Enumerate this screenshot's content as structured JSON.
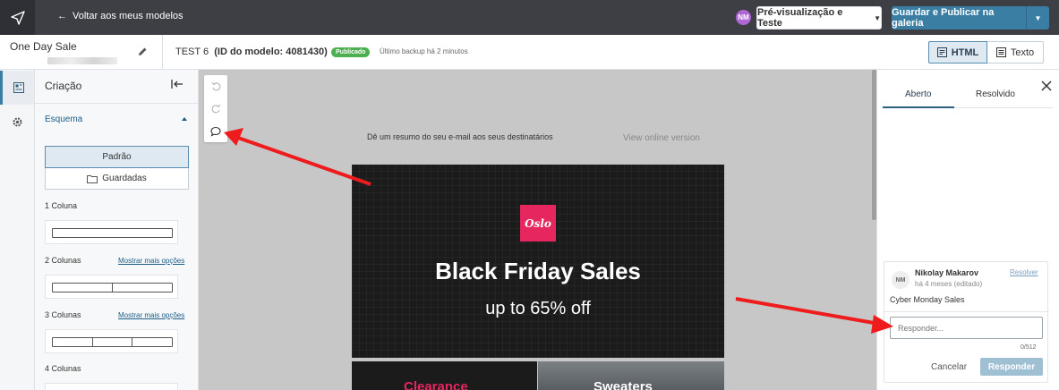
{
  "topbar": {
    "back_label": "Voltar aos meus modelos",
    "user_initials": "NM",
    "preview_label": "Pré-visualização e Teste",
    "publish_label": "Guardar e Publicar na galeria"
  },
  "subbar": {
    "template_name": "One Day Sale",
    "template_title": "TEST 6",
    "template_id": "(ID do modelo: 4081430)",
    "status_badge": "Publicado",
    "backup_text": "Último backup há 2 minutos",
    "html_label": "HTML",
    "text_label": "Texto"
  },
  "panel": {
    "title": "Criação",
    "section": "Esquema",
    "padrao_label": "Padrão",
    "guardadas_label": "Guardadas",
    "col1": "1 Coluna",
    "col2": "2 Colunas",
    "col3": "3 Colunas",
    "col4": "4 Colunas",
    "more_options": "Mostrar mais opções"
  },
  "canvas": {
    "preheader": "Dê um resumo do seu e-mail aos seus destinatários",
    "view_online": "View online version",
    "logo_text": "Oslo",
    "headline": "Black Friday Sales",
    "subheadline": "up to 65% off",
    "tile1": "Clearance",
    "tile2": "Sweaters"
  },
  "comments": {
    "tab_open": "Aberto",
    "tab_resolved": "Resolvido",
    "author_initials": "NM",
    "author": "Nikolay Makarov",
    "time": "há 4 meses (editado)",
    "resolve_label": "Resolver",
    "comment_text": "Cyber Monday Sales",
    "reply_placeholder": "Responder...",
    "counter": "0/512",
    "cancel_label": "Cancelar",
    "reply_label": "Responder"
  },
  "colors": {
    "accent": "#3a7ea4",
    "brand_pink": "#e6265f",
    "annotation_arrow": "#ee1c1c"
  },
  "icons": [
    "send-icon",
    "back-arrow-icon",
    "pencil-icon",
    "html-icon",
    "text-doc-icon",
    "layout-icon",
    "gear-icon",
    "collapse-icon",
    "folder-icon",
    "undo-icon",
    "redo-icon",
    "comment-icon",
    "close-icon",
    "caret-down-icon"
  ]
}
